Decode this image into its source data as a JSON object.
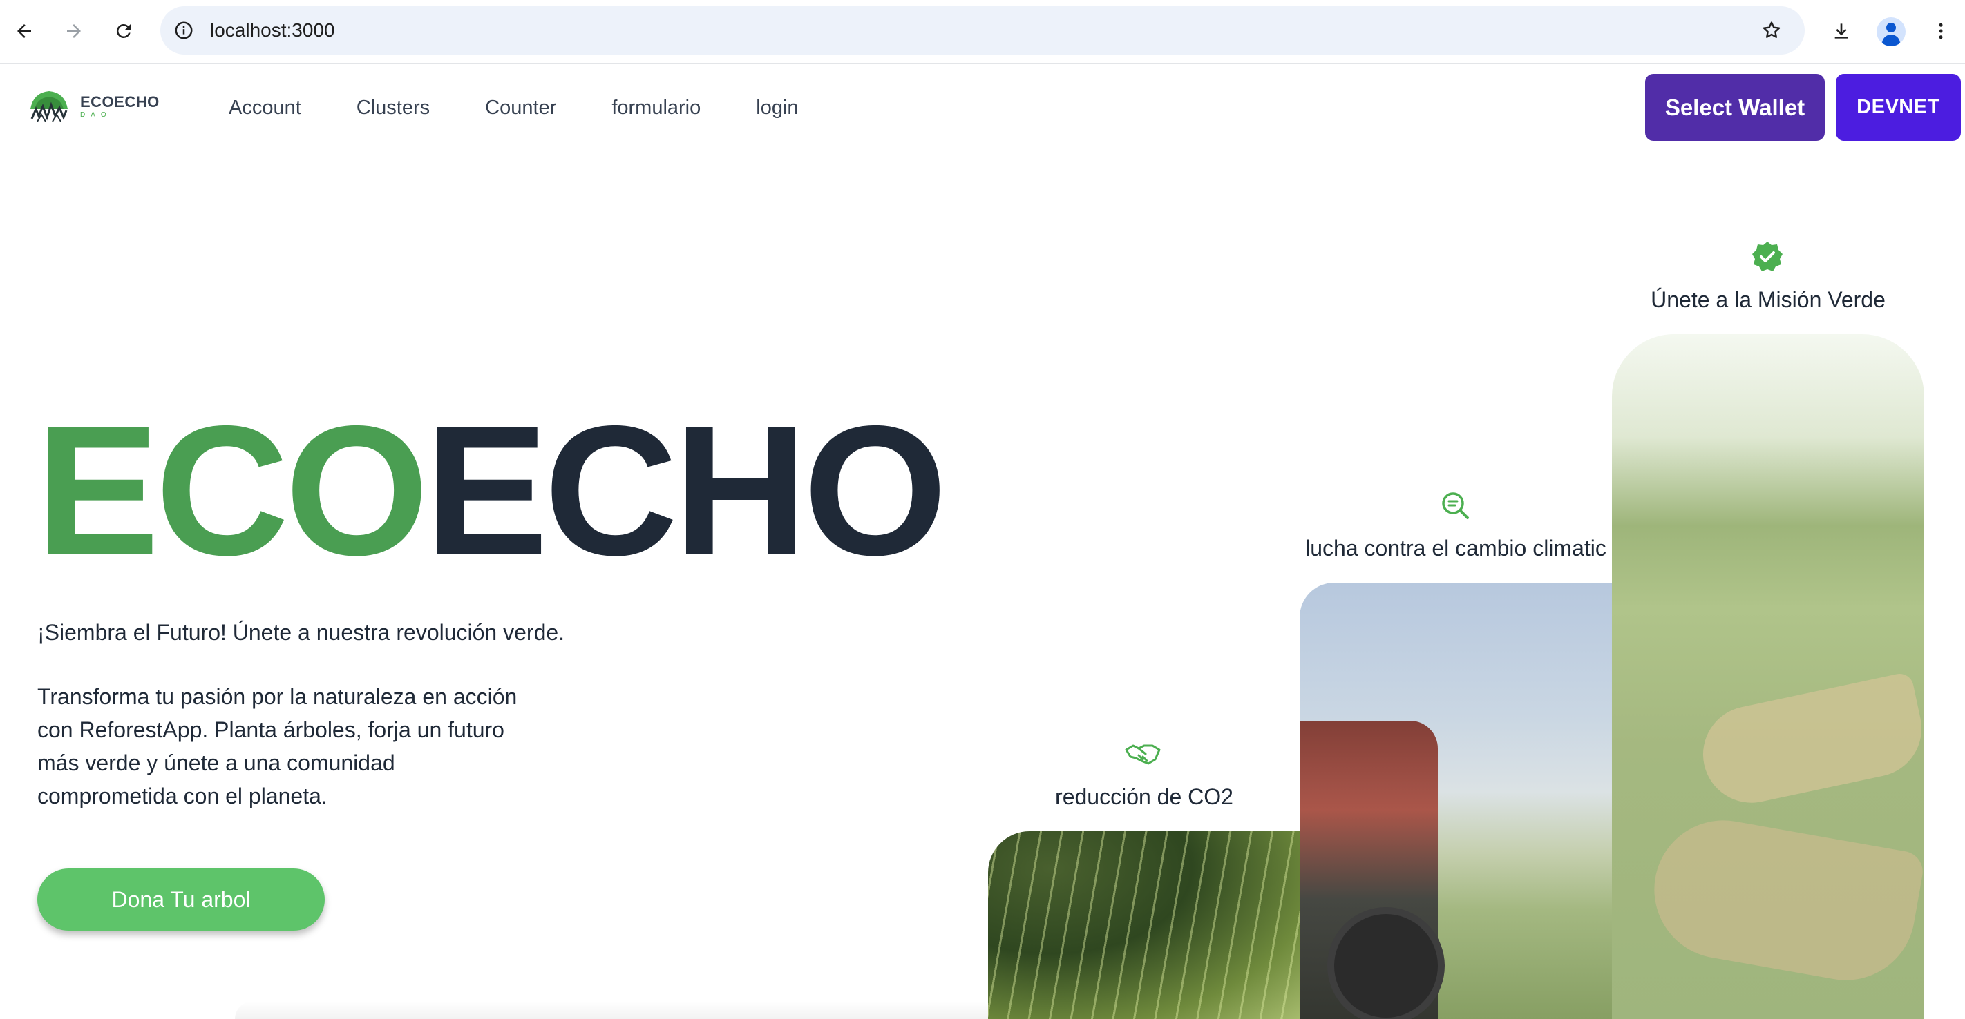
{
  "browser": {
    "url": "localhost:3000",
    "icons": [
      "back-arrow-icon",
      "forward-arrow-icon",
      "reload-icon",
      "site-info-icon",
      "bookmark-star-icon",
      "download-icon",
      "profile-icon",
      "more-menu-icon"
    ]
  },
  "brand": {
    "name": "ECOECHO",
    "sub": "DAO"
  },
  "nav": {
    "items": [
      "Account",
      "Clusters",
      "Counter",
      "formulario",
      "login"
    ]
  },
  "wallet": {
    "select_label": "Select Wallet",
    "network_label": "DEVNET"
  },
  "hero": {
    "title_green": "ECO",
    "title_dark": "ECHO",
    "tagline": "¡Siembra el Futuro! Únete a nuestra revolución verde.",
    "description": "Transforma tu pasión por la naturaleza en acción con ReforestApp. Planta árboles, forja un futuro más verde y únete a una comunidad comprometida con el planeta.",
    "cta_label": "Dona Tu arbol"
  },
  "features": [
    {
      "label": "reducción de CO2",
      "icon": "handshake-icon"
    },
    {
      "label": "lucha contra el cambio climatic",
      "icon": "search-chat-icon"
    },
    {
      "label": "Únete a la Misión Verde",
      "icon": "verified-badge-icon"
    }
  ],
  "colors": {
    "brand_green": "#4a9e52",
    "cta_green": "#5ec46a",
    "dark_text": "#1f2937",
    "wallet_purple": "#512da8",
    "devnet_purple": "#4c1de0"
  }
}
